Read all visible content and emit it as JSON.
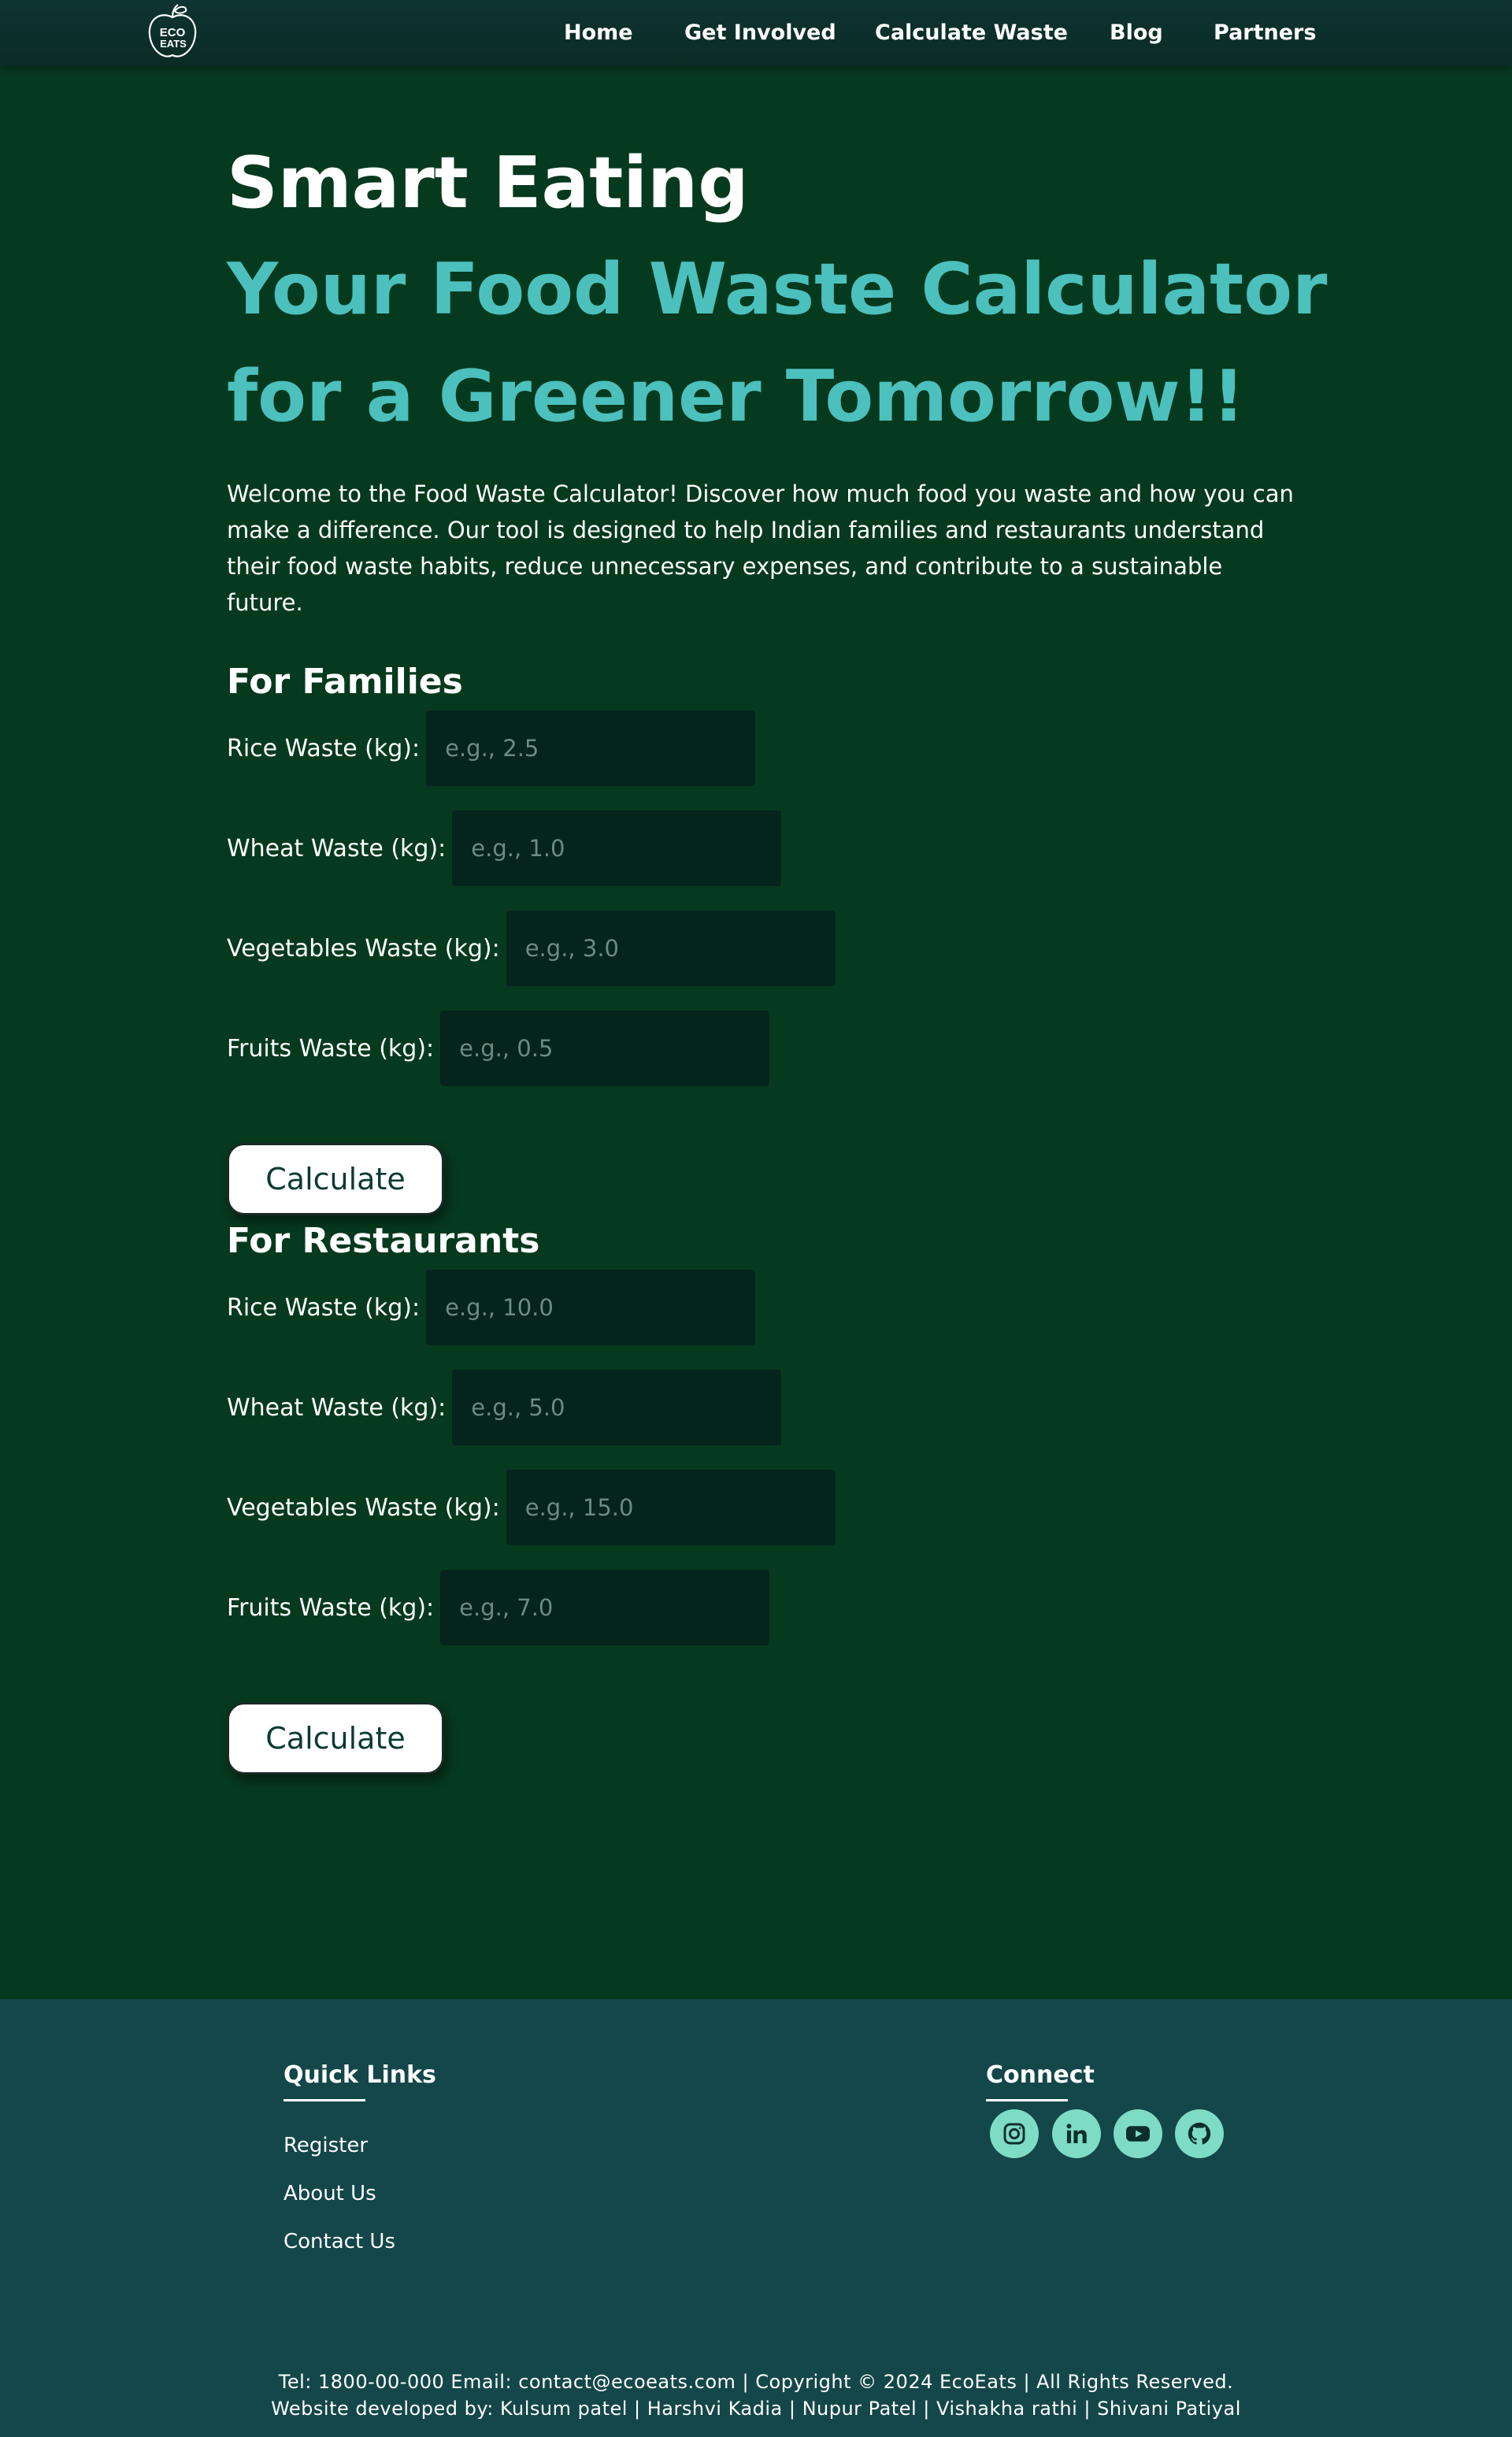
{
  "nav": {
    "logo_text": "ECO EATS",
    "links": [
      "Home",
      "Get Involved",
      "Calculate Waste",
      "Blog",
      "Partners"
    ]
  },
  "hero": {
    "title": "Smart Eating",
    "subtitle_line1": "Your Food Waste Calculator",
    "subtitle_line2": "for a Greener Tomorrow!!",
    "intro": "Welcome to the Food Waste Calculator! Discover how much food you waste and how you can make a difference. Our tool is designed to help Indian families and restaurants understand their food waste habits, reduce unnecessary expenses, and contribute to a sustainable future."
  },
  "families": {
    "heading": "For Families",
    "fields": [
      {
        "label": "Rice Waste (kg):",
        "placeholder": "e.g., 2.5"
      },
      {
        "label": "Wheat Waste (kg):",
        "placeholder": "e.g., 1.0"
      },
      {
        "label": "Vegetables Waste (kg):",
        "placeholder": "e.g., 3.0"
      },
      {
        "label": "Fruits Waste (kg):",
        "placeholder": "e.g., 0.5"
      }
    ],
    "button": "Calculate"
  },
  "restaurants": {
    "heading": "For Restaurants",
    "fields": [
      {
        "label": "Rice Waste (kg):",
        "placeholder": "e.g., 10.0"
      },
      {
        "label": "Wheat Waste (kg):",
        "placeholder": "e.g., 5.0"
      },
      {
        "label": "Vegetables Waste (kg):",
        "placeholder": "e.g., 15.0"
      },
      {
        "label": "Fruits Waste (kg):",
        "placeholder": "e.g., 7.0"
      }
    ],
    "button": "Calculate"
  },
  "footer": {
    "quick_links_title": "Quick Links",
    "quick_links": [
      "Register",
      "About Us",
      "Contact Us"
    ],
    "connect_title": "Connect",
    "social_icons": [
      "instagram-icon",
      "linkedin-icon",
      "youtube-icon",
      "github-icon"
    ],
    "contact_line": "Tel: 1800-00-000 Email: contact@ecoeats.com | Copyright © 2024 EcoEats | All Rights Reserved.",
    "credits_line": "Website developed by: Kulsum patel | Harshvi Kadia | Nupur Patel | Vishakha rathi | Shivani Patiyal"
  },
  "colors": {
    "background": "#063a1e",
    "navbar": "#0e3431",
    "accent": "#4cc0bd",
    "input_bg": "#04241c",
    "footer_bg": "#14474a",
    "social_icon_bg": "#7edcc4"
  }
}
